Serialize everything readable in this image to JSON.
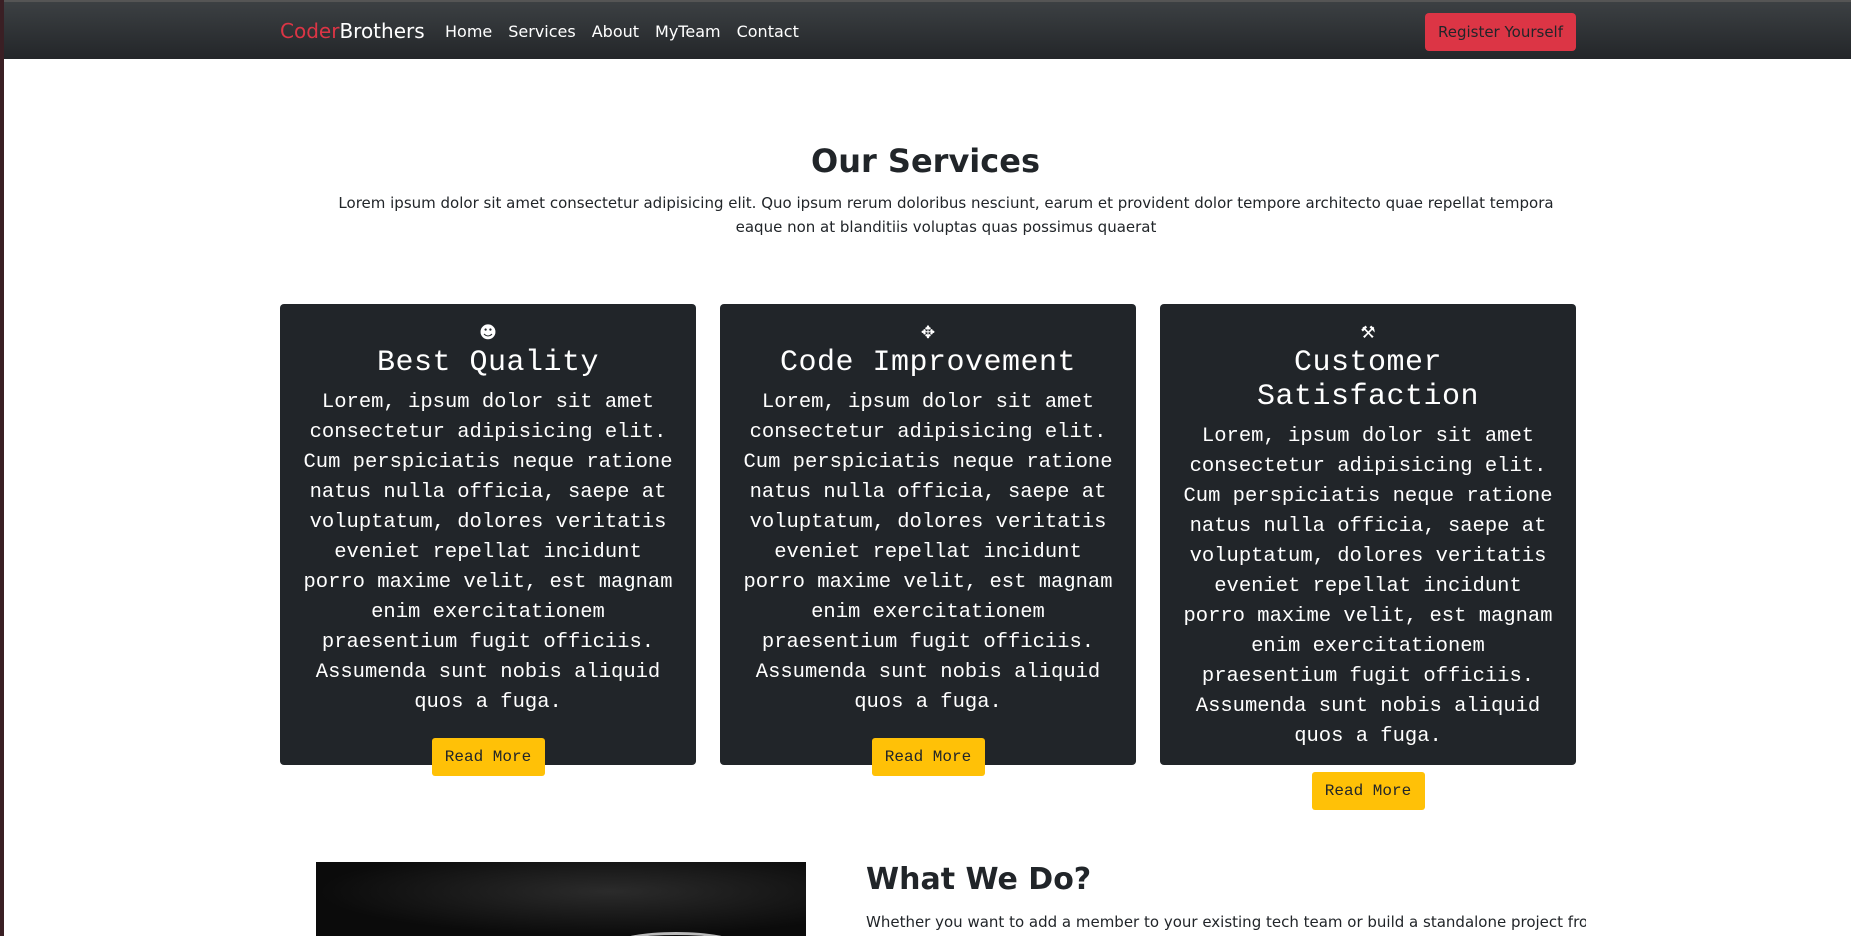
{
  "navbar": {
    "brand_part1": "Coder",
    "brand_part2": "Brothers",
    "links": [
      "Home",
      "Services",
      "About",
      "MyTeam",
      "Contact"
    ],
    "register_label": "Register Yourself"
  },
  "services": {
    "title": "Our Services",
    "description": "Lorem ipsum dolor sit amet consectetur adipisicing elit. Quo ipsum rerum doloribus nesciunt, earum et provident dolor tempore architecto quae repellat tempora eaque non at blanditiis voluptas quas possimus quaerat",
    "cards": [
      {
        "icon": "smile-icon",
        "icon_glyph": "☻",
        "title": "Best Quality",
        "text": "Lorem, ipsum dolor sit amet consectetur adipisicing elit. Cum perspiciatis neque ratione natus nulla officia, saepe at voluptatum, dolores veritatis eveniet repellat incidunt porro maxime velit, est magnam enim exercitationem praesentium fugit officiis. Assumenda sunt nobis aliquid quos a fuga.",
        "button": "Read More"
      },
      {
        "icon": "slack-icon",
        "icon_glyph": "✥",
        "title": "Code Improvement",
        "text": "Lorem, ipsum dolor sit amet consectetur adipisicing elit. Cum perspiciatis neque ratione natus nulla officia, saepe at voluptatum, dolores veritatis eveniet repellat incidunt porro maxime velit, est magnam enim exercitationem praesentium fugit officiis. Assumenda sunt nobis aliquid quos a fuga.",
        "button": "Read More"
      },
      {
        "icon": "wrench-icon",
        "icon_glyph": "⚒",
        "title": "Customer Satisfaction",
        "text": "Lorem, ipsum dolor sit amet consectetur adipisicing elit. Cum perspiciatis neque ratione natus nulla officia, saepe at voluptatum, dolores veritatis eveniet repellat incidunt porro maxime velit, est magnam enim exercitationem praesentium fugit officiis. Assumenda sunt nobis aliquid quos a fuga.",
        "button": "Read More"
      }
    ]
  },
  "what_we_do": {
    "title": "What We Do?",
    "text": "Whether you want to add a member to your existing tech team or build a standalone project from"
  },
  "colors": {
    "brand_red": "#dc3545",
    "card_bg": "#212529",
    "button_yellow": "#ffc107",
    "navbar_dark": "#2b2e31"
  }
}
